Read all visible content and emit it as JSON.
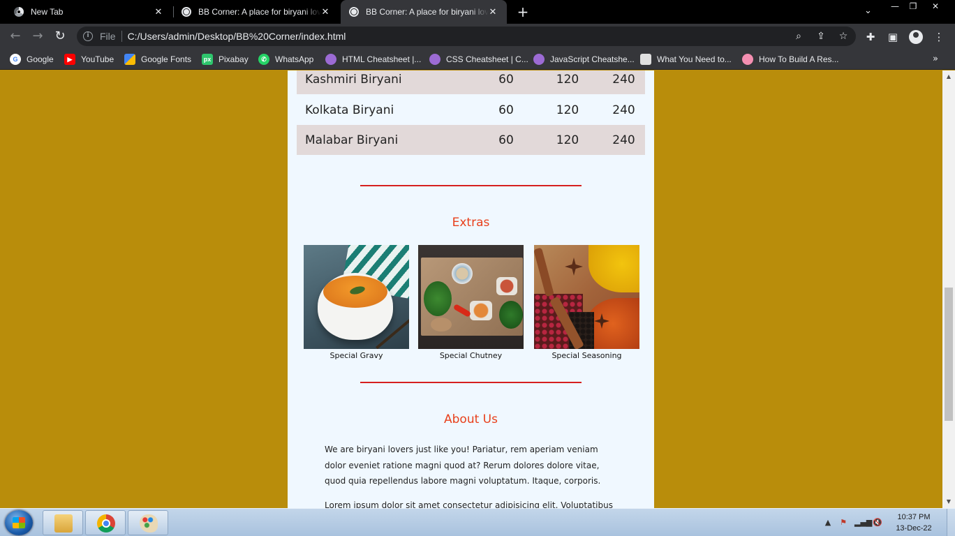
{
  "browser": {
    "tabs": [
      {
        "title": "New Tab",
        "active": false
      },
      {
        "title": "BB Corner: A place for biryani lov",
        "active": false
      },
      {
        "title": "BB Corner: A place for biryani lov",
        "active": true
      }
    ],
    "omnibox": {
      "scheme": "File",
      "url": "C:/Users/admin/Desktop/BB%20Corner/index.html"
    },
    "bookmarks": [
      {
        "label": "Google",
        "icon": "google-icon",
        "color": "#ffffff"
      },
      {
        "label": "YouTube",
        "icon": "youtube-icon",
        "color": "#ff0000"
      },
      {
        "label": "Google Fonts",
        "icon": "google-fonts-icon",
        "color": "#4285f4"
      },
      {
        "label": "Pixabay",
        "icon": "pixabay-icon",
        "color": "#2ec66d"
      },
      {
        "label": "WhatsApp",
        "icon": "whatsapp-icon",
        "color": "#25d366"
      },
      {
        "label": "HTML Cheatsheet |...",
        "icon": "avatar-icon",
        "color": "#9c6bd4"
      },
      {
        "label": "CSS Cheatsheet | C...",
        "icon": "avatar-icon",
        "color": "#9c6bd4"
      },
      {
        "label": "JavaScript Cheatshe...",
        "icon": "avatar-icon",
        "color": "#9c6bd4"
      },
      {
        "label": "What You Need to...",
        "icon": "site-icon",
        "color": "#e0e0e0"
      },
      {
        "label": "How To Build A Res...",
        "icon": "site-icon",
        "color": "#f48fb1"
      }
    ]
  },
  "page": {
    "background": "#b98d0b",
    "accent": "#e8401c",
    "menu_rows": [
      {
        "name": "Kashmiri Biryani",
        "p1": "60",
        "p2": "120",
        "p3": "240",
        "shaded": true
      },
      {
        "name": "Kolkata Biryani",
        "p1": "60",
        "p2": "120",
        "p3": "240",
        "shaded": false
      },
      {
        "name": "Malabar Biryani",
        "p1": "60",
        "p2": "120",
        "p3": "240",
        "shaded": true
      }
    ],
    "extras": {
      "title": "Extras",
      "items": [
        {
          "caption": "Special Gravy"
        },
        {
          "caption": "Special Chutney"
        },
        {
          "caption": "Special Seasoning"
        }
      ]
    },
    "about": {
      "title": "About Us",
      "para1": "We are biryani lovers just like you! Pariatur, rem aperiam veniam dolor eveniet ratione magni quod at? Rerum dolores dolore vitae, quod quia repellendus labore magni voluptatum. Itaque, corporis.",
      "para2": "Lorem ipsum dolor sit amet consectetur adipisicing elit. Voluptatibus"
    }
  },
  "taskbar": {
    "time": "10:37 PM",
    "date": "13-Dec-22"
  }
}
